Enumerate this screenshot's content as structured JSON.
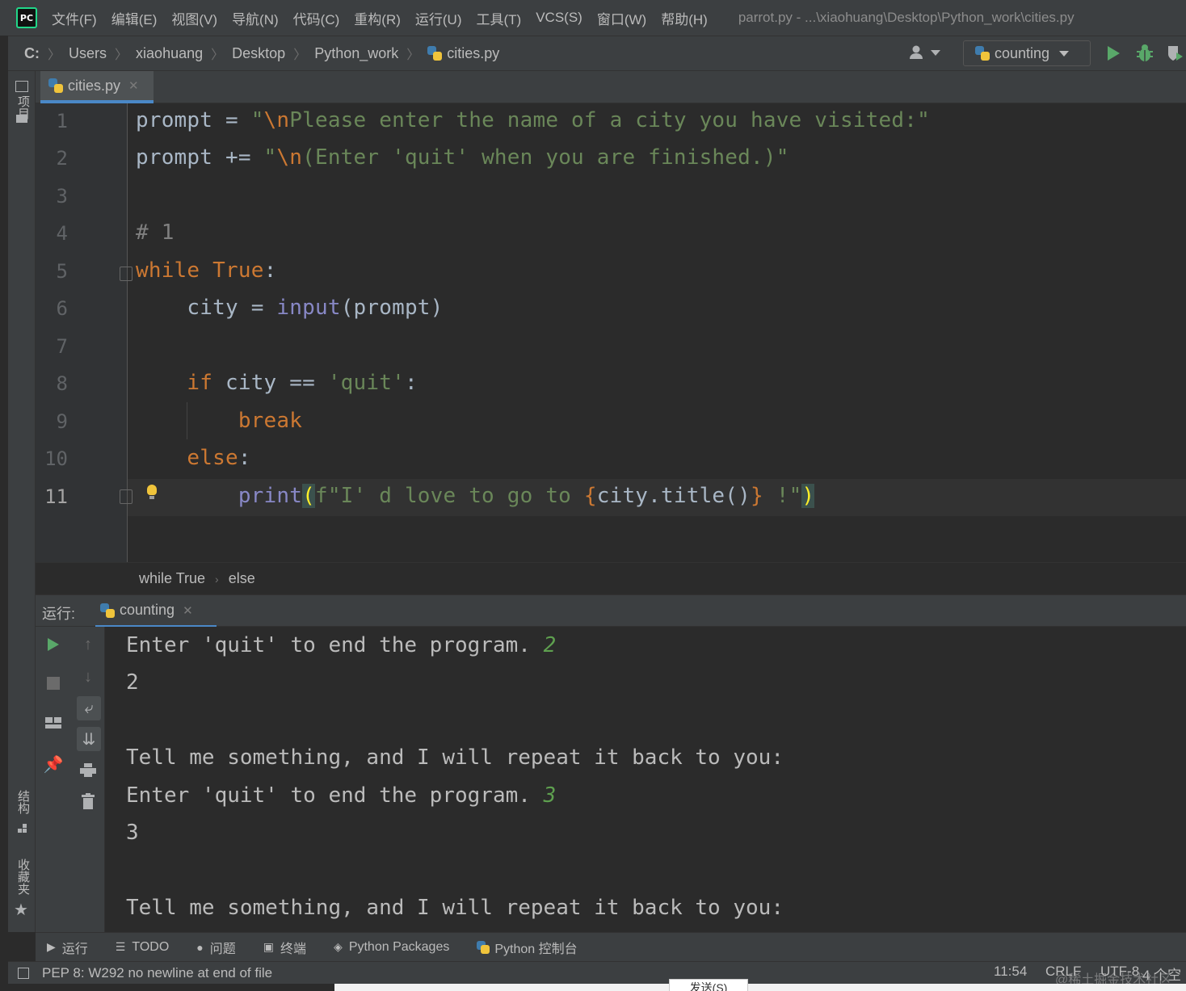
{
  "menubar": {
    "logo": "PC",
    "items": [
      "文件(F)",
      "编辑(E)",
      "视图(V)",
      "导航(N)",
      "代码(C)",
      "重构(R)",
      "运行(U)",
      "工具(T)",
      "VCS(S)",
      "窗口(W)",
      "帮助(H)"
    ],
    "title": "parrot.py - ...\\xiaohuang\\Desktop\\Python_work\\cities.py"
  },
  "navbar": {
    "breadcrumbs": [
      "C:",
      "Users",
      "xiaohuang",
      "Desktop",
      "Python_work",
      "cities.py"
    ],
    "run_config": "counting"
  },
  "left_strip": {
    "project": "项目",
    "structure": "结构",
    "favorites": "收藏夹"
  },
  "editor": {
    "tab_label": "cities.py",
    "line_numbers": [
      "1",
      "2",
      "3",
      "4",
      "5",
      "6",
      "7",
      "8",
      "9",
      "10",
      "11"
    ],
    "current_line": "11",
    "lines": {
      "l1": {
        "var": "prompt",
        "op": " = ",
        "str": "\"",
        "esc": "\\n",
        "str2": "Please enter the name of a city you have visited:\""
      },
      "l2": {
        "var": "prompt",
        "op": " += ",
        "str": "\"",
        "esc": "\\n",
        "str2": "(Enter 'quit' when you are finished.)\""
      },
      "l4": {
        "comment": "# 1"
      },
      "l5": {
        "kw": "while",
        "sp": " ",
        "kw2": "True",
        "punct": ":"
      },
      "l6": {
        "indent": "    ",
        "var": "city",
        "op": " = ",
        "fn": "input",
        "rest": "(prompt)"
      },
      "l8": {
        "indent": "    ",
        "kw": "if",
        "mid": " city == ",
        "str": "'quit'",
        "punct": ":"
      },
      "l9": {
        "indent": "        ",
        "kw": "break"
      },
      "l10": {
        "indent": "    ",
        "kw": "else",
        "punct": ":"
      },
      "l11": {
        "indent": "        ",
        "fn": "print",
        "open": "(",
        "str": "f\"I' d love to go to ",
        "brace_open": "{",
        "expr": "city.title()",
        "brace_close": "}",
        "str_end": " !\"",
        "close": ")"
      }
    }
  },
  "crumbbar": {
    "items": [
      "while True",
      "else"
    ]
  },
  "run_panel": {
    "label": "运行:",
    "tab": "counting"
  },
  "console": {
    "lines": [
      {
        "text": "Enter 'quit' to end the program. ",
        "input": "2"
      },
      {
        "text": "2",
        "input": ""
      },
      {
        "text": "",
        "input": ""
      },
      {
        "text": "Tell me something, and I will repeat it back to you:",
        "input": ""
      },
      {
        "text": "Enter 'quit' to end the program. ",
        "input": "3"
      },
      {
        "text": "3",
        "input": ""
      },
      {
        "text": "",
        "input": ""
      },
      {
        "text": "Tell me something, and I will repeat it back to you:",
        "input": ""
      }
    ]
  },
  "bottom_tools": [
    "运行",
    "TODO",
    "问题",
    "终端",
    "Python Packages",
    "Python 控制台"
  ],
  "status": {
    "message": "PEP 8: W292 no newline at end of file",
    "position": "11:54",
    "line_sep": "CRLF",
    "encoding": "UTF-8",
    "indent": "4 个空"
  },
  "overlay": {
    "send_button": "发送(S)",
    "watermark": "@稀土掘金技术社区"
  },
  "colors": {
    "keyword": "#cc7832",
    "string": "#6a8759",
    "builtin": "#8888c6",
    "comment": "#808080",
    "console_input": "#5ea04f",
    "run_green": "#59a869",
    "accent_blue": "#4a88c7"
  }
}
